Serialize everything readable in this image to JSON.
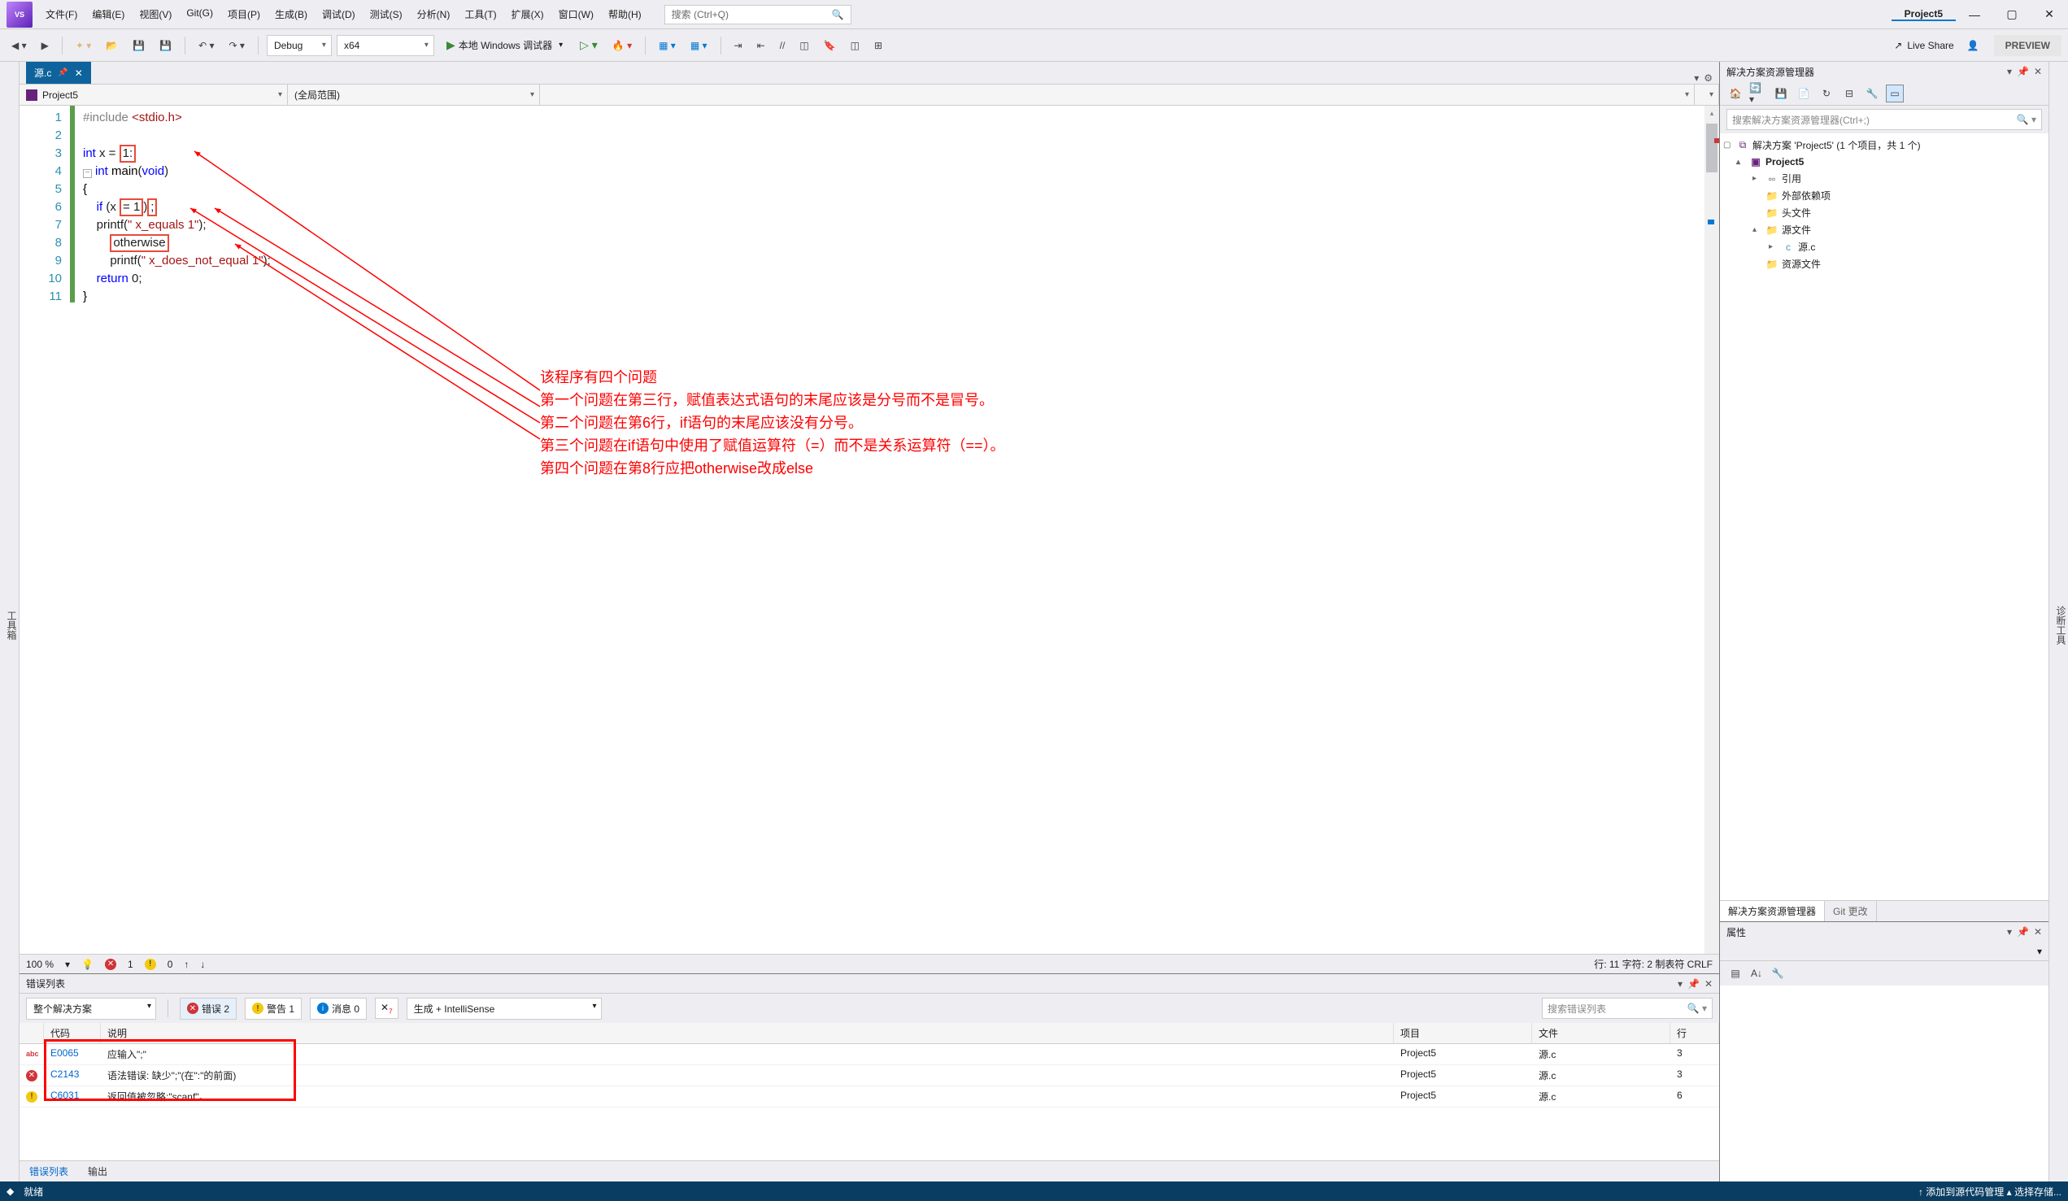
{
  "title": "Project5",
  "menus": [
    "文件(F)",
    "编辑(E)",
    "视图(V)",
    "Git(G)",
    "项目(P)",
    "生成(B)",
    "调试(D)",
    "测试(S)",
    "分析(N)",
    "工具(T)",
    "扩展(X)",
    "窗口(W)",
    "帮助(H)"
  ],
  "search_placeholder": "搜索 (Ctrl+Q)",
  "toolbar": {
    "config": "Debug",
    "platform": "x64",
    "run": "本地 Windows 调试器",
    "liveshare": "Live Share",
    "preview": "PREVIEW"
  },
  "left_rail": "工具箱",
  "right_rail": "诊断工具",
  "editor": {
    "tab": "源.c",
    "nav_left": "Project5",
    "nav_mid": "(全局范围)",
    "lines": [
      {
        "n": 1,
        "html": "<span class='pp'>#include</span> <span class='inc'>&lt;stdio.h&gt;</span>"
      },
      {
        "n": 2,
        "html": ""
      },
      {
        "n": 3,
        "html": "<span class='type'>int</span> x = <span class='red-box'>1:</span>"
      },
      {
        "n": 4,
        "html": "<span class='collapse-dash'>−</span><span class='type'>int</span> <span class='fn'>main</span>(<span class='type'>void</span>)"
      },
      {
        "n": 5,
        "html": "<span class='curly'>{</span>"
      },
      {
        "n": 6,
        "html": "    <span class='kw'>if</span> (x <span class='red-box'>= 1</span>)<span class='red-box'>;</span>"
      },
      {
        "n": 7,
        "html": "    printf(<span class='str'>\" x_equals 1\"</span>);"
      },
      {
        "n": 8,
        "html": "        <span class='red-box'>otherwise</span>"
      },
      {
        "n": 9,
        "html": "        printf(<span class='str'>\" x_does_not_equal 1\"</span>);"
      },
      {
        "n": 10,
        "html": "    <span class='kw'>return</span> 0;"
      },
      {
        "n": 11,
        "html": "<span class='curly'>}</span>"
      }
    ],
    "annotation": [
      "该程序有四个问题",
      "第一个问题在第三行，赋值表达式语句的末尾应该是分号而不是冒号。",
      "第二个问题在第6行，if语句的末尾应该没有分号。",
      "第三个问题在if语句中使用了赋值运算符（=）而不是关系运算符（==）。",
      "第四个问题在第8行应把otherwise改成else"
    ],
    "status": {
      "zoom": "100 %",
      "errors": "1",
      "warnings": "0",
      "pos": "行: 11    字符: 2    制表符    CRLF"
    }
  },
  "errorlist": {
    "title": "错误列表",
    "scope": "整个解决方案",
    "btn_err": "错误 2",
    "btn_warn": "警告 1",
    "btn_info": "消息 0",
    "source": "生成 + IntelliSense",
    "search": "搜索错误列表",
    "cols": [
      "",
      "代码",
      "说明",
      "项目",
      "文件",
      "行"
    ],
    "rows": [
      {
        "icon": "abc",
        "code": "E0065",
        "desc": "应输入\";\"",
        "proj": "Project5",
        "file": "源.c",
        "line": "3"
      },
      {
        "icon": "err",
        "code": "C2143",
        "desc": "语法错误: 缺少\";\"(在\":\"的前面)",
        "proj": "Project5",
        "file": "源.c",
        "line": "3"
      },
      {
        "icon": "warn",
        "code": "C6031",
        "desc": "返回值被忽略:\"scanf\"。",
        "proj": "Project5",
        "file": "源.c",
        "line": "6"
      }
    ],
    "tabs": [
      "错误列表",
      "输出"
    ]
  },
  "solution": {
    "title": "解决方案资源管理器",
    "search": "搜索解决方案资源管理器(Ctrl+;)",
    "root": "解决方案 'Project5' (1 个项目，共 1 个)",
    "project": "Project5",
    "nodes": [
      "引用",
      "外部依赖项",
      "头文件",
      "源文件",
      "源.c",
      "资源文件"
    ],
    "tabs": [
      "解决方案资源管理器",
      "Git 更改"
    ]
  },
  "properties": {
    "title": "属性"
  },
  "statusbar": {
    "ready": "就绪",
    "right": "↑ 添加到源代码管理 ▴    选择存储..."
  }
}
